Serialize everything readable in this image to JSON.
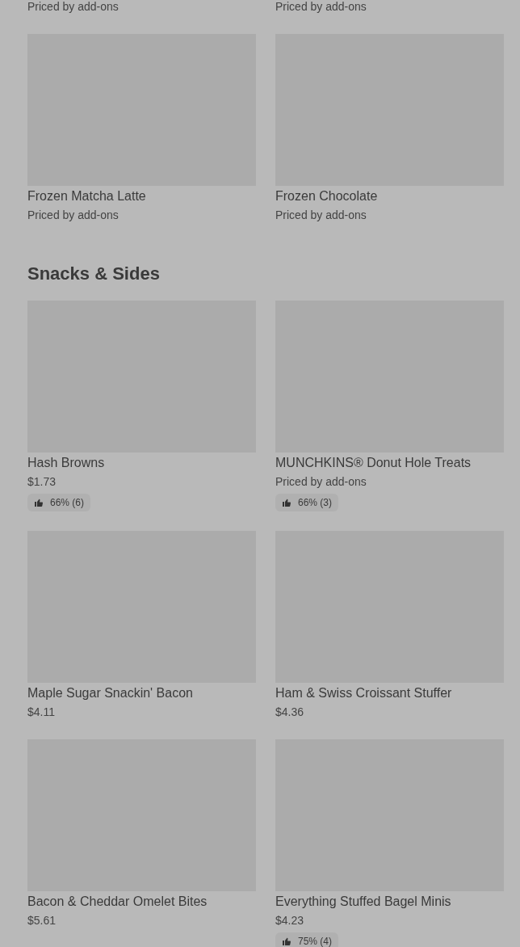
{
  "sections": [
    {
      "items": [
        {
          "subtitle": "Priced by add-ons"
        },
        {
          "subtitle": "Priced by add-ons"
        },
        {
          "kind": "card",
          "name": "Frozen Matcha Latte",
          "subtitle": "Priced by add-ons"
        },
        {
          "kind": "card",
          "name": "Frozen Chocolate",
          "subtitle": "Priced by add-ons"
        }
      ]
    },
    {
      "title": "Snacks & Sides",
      "items": [
        {
          "kind": "card",
          "name": "Hash Browns",
          "subtitle": "$1.73",
          "rating": "66% (6)"
        },
        {
          "kind": "card",
          "name": "MUNCHKINS® Donut Hole Treats",
          "subtitle": "Priced by add-ons",
          "rating": "66% (3)"
        },
        {
          "kind": "card",
          "name": "Maple Sugar Snackin' Bacon",
          "subtitle": "$4.11"
        },
        {
          "kind": "card",
          "name": "Ham & Swiss Croissant Stuffer",
          "subtitle": "$4.36"
        },
        {
          "kind": "card",
          "name": "Bacon & Cheddar Omelet Bites",
          "subtitle": "$5.61"
        },
        {
          "kind": "card",
          "name": "Everything Stuffed Bagel Minis",
          "subtitle": "$4.23",
          "rating": "75% (4)"
        }
      ]
    }
  ]
}
